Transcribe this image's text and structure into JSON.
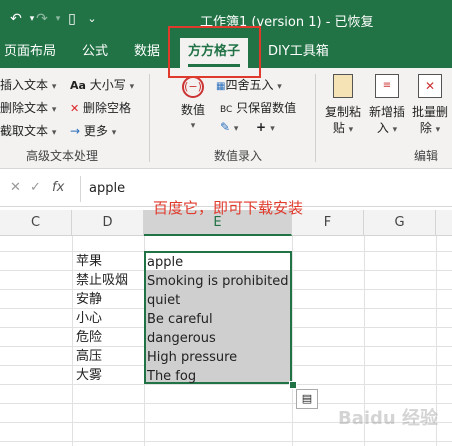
{
  "title_bar": {
    "doc_title": "工作簿1 (version 1) - 已恢复"
  },
  "tabs": [
    {
      "label": "页面布局"
    },
    {
      "label": "公式"
    },
    {
      "label": "数据"
    },
    {
      "label": "方方格子",
      "active": true
    },
    {
      "label": "DIY工具箱"
    }
  ],
  "ribbon": {
    "col1": [
      "插入文本",
      "删除文本",
      "截取文本"
    ],
    "col2": [
      "大小写",
      "删除空格",
      "更多"
    ],
    "group1_label": "高级文本处理",
    "value_button": "数值",
    "round_button": "四舍五入",
    "keep_value_button": "只保留数值",
    "group2_label": "数值录入",
    "copy_paste_button": {
      "line1": "复制粘",
      "line2": "贴"
    },
    "add_insert_button": {
      "line1": "新增插",
      "line2": "入"
    },
    "batch_delete_button": {
      "line1": "批量删",
      "line2": "除"
    },
    "group3_label": "编辑"
  },
  "formula_bar": {
    "fx": "fx",
    "value": "apple"
  },
  "columns": [
    "C",
    "D",
    "E",
    "F",
    "G"
  ],
  "rows": [
    {
      "d": "苹果",
      "e": "apple"
    },
    {
      "d": "禁止吸烟",
      "e": "Smoking is prohibited"
    },
    {
      "d": "安静",
      "e": "quiet"
    },
    {
      "d": "小心",
      "e": "Be careful"
    },
    {
      "d": "危险",
      "e": "dangerous"
    },
    {
      "d": "高压",
      "e": "High pressure"
    },
    {
      "d": "大雾",
      "e": "The fog"
    }
  ],
  "annotation": "百度它，即可下载安装",
  "watermark": "Baidu 经验",
  "colors": {
    "excel_green": "#217346",
    "highlight_red": "#e03a2c"
  }
}
